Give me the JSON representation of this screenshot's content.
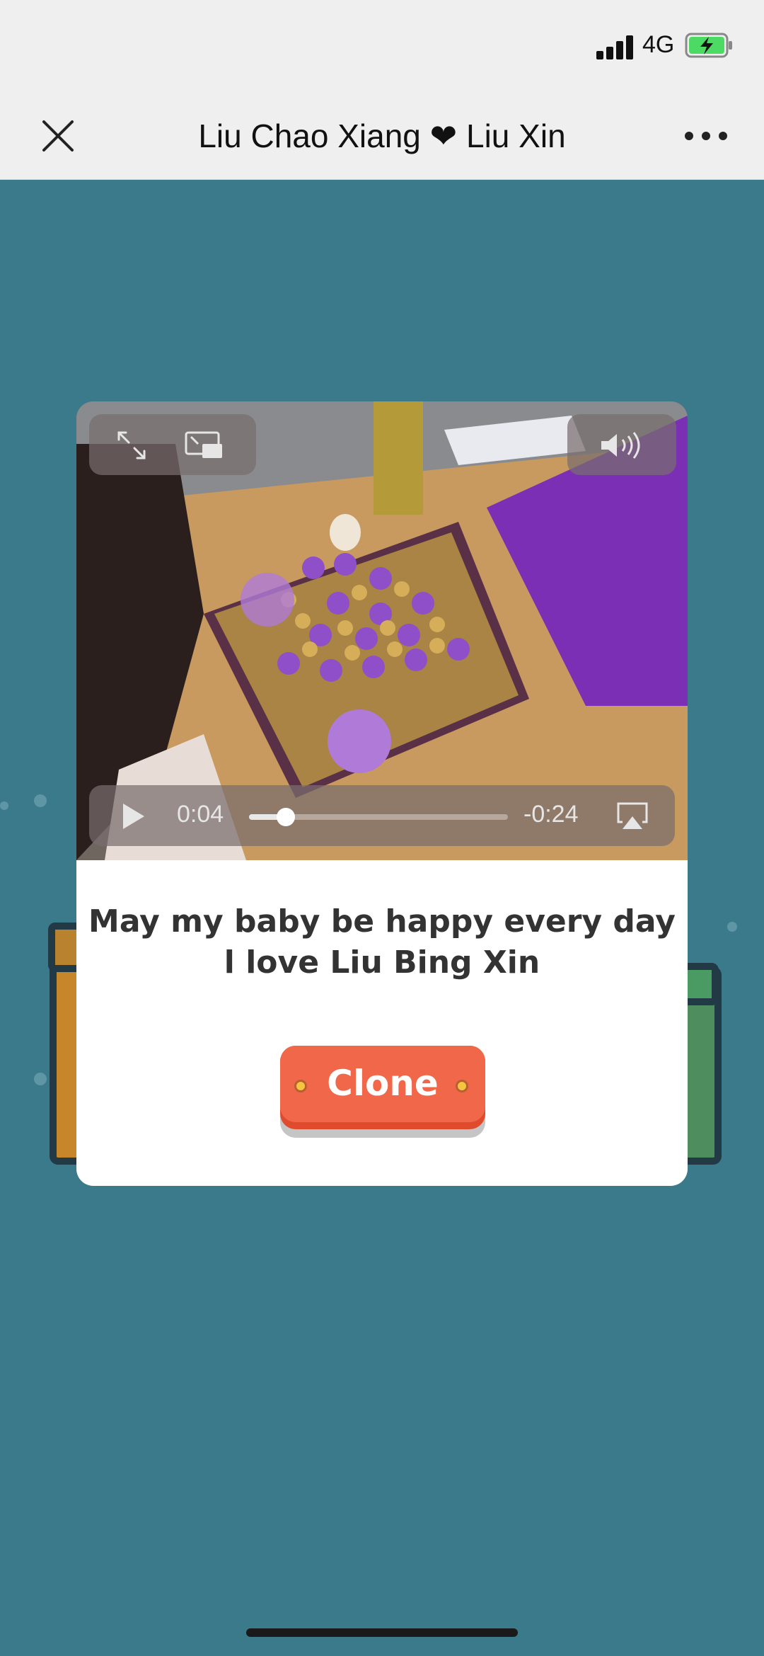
{
  "status_bar": {
    "network": "4G",
    "battery_charging": true,
    "signal_bars": 4
  },
  "nav": {
    "title": "Liu Chao Xiang ❤ Liu Xin",
    "close_icon": "close-icon",
    "more_icon": "more-icon"
  },
  "video": {
    "current_time": "0:04",
    "remaining_time": "-0:24",
    "progress": 0.143,
    "icons": [
      "fullscreen-icon",
      "picture-in-picture-icon",
      "volume-icon",
      "play-icon",
      "airplay-icon"
    ]
  },
  "message": {
    "line1": "May my baby be happy every day",
    "line2": "l love Liu Bing Xin"
  },
  "clone_button": {
    "label": "Clone"
  },
  "colors": {
    "background": "#3a7a8b",
    "button": "#f0674a",
    "text": "#333333"
  }
}
